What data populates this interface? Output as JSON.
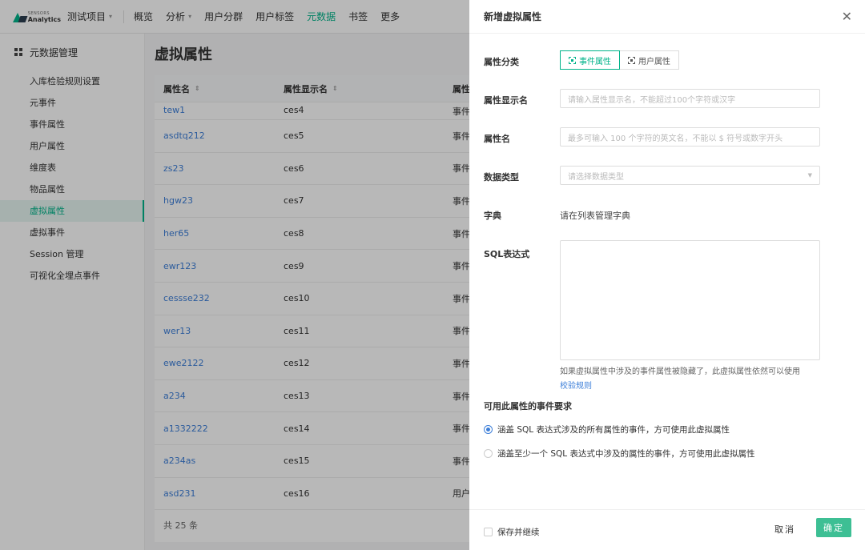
{
  "topnav": {
    "logo_line1": "SENSORS",
    "logo_line2": "Analytics",
    "project": "测试项目",
    "items": [
      {
        "label": "概览",
        "caret": false,
        "active": false
      },
      {
        "label": "分析",
        "caret": true,
        "active": false
      },
      {
        "label": "用户分群",
        "caret": false,
        "active": false
      },
      {
        "label": "用户标签",
        "caret": false,
        "active": false
      },
      {
        "label": "元数据",
        "caret": false,
        "active": true
      },
      {
        "label": "书签",
        "caret": false,
        "active": false
      },
      {
        "label": "更多",
        "caret": false,
        "active": false
      }
    ]
  },
  "sidebar": {
    "title": "元数据管理",
    "items": [
      {
        "label": "入库检验规则设置",
        "active": false
      },
      {
        "label": "元事件",
        "active": false
      },
      {
        "label": "事件属性",
        "active": false
      },
      {
        "label": "用户属性",
        "active": false
      },
      {
        "label": "维度表",
        "active": false
      },
      {
        "label": "物品属性",
        "active": false
      },
      {
        "label": "虚拟属性",
        "active": true
      },
      {
        "label": "虚拟事件",
        "active": false
      },
      {
        "label": "Session 管理",
        "active": false
      },
      {
        "label": "可视化全埋点事件",
        "active": false
      }
    ]
  },
  "main": {
    "title": "虚拟属性",
    "columns": [
      "属性名",
      "属性显示名",
      "属性"
    ],
    "rows": [
      {
        "name": "tew1",
        "display": "ces4",
        "type": "事件"
      },
      {
        "name": "asdtq212",
        "display": "ces5",
        "type": "事件"
      },
      {
        "name": "zs23",
        "display": "ces6",
        "type": "事件"
      },
      {
        "name": "hgw23",
        "display": "ces7",
        "type": "事件"
      },
      {
        "name": "her65",
        "display": "ces8",
        "type": "事件"
      },
      {
        "name": "ewr123",
        "display": "ces9",
        "type": "事件"
      },
      {
        "name": "cessse232",
        "display": "ces10",
        "type": "事件"
      },
      {
        "name": "wer13",
        "display": "ces11",
        "type": "事件"
      },
      {
        "name": "ewe2122",
        "display": "ces12",
        "type": "事件"
      },
      {
        "name": "a234",
        "display": "ces13",
        "type": "事件"
      },
      {
        "name": "a1332222",
        "display": "ces14",
        "type": "事件"
      },
      {
        "name": "a234as",
        "display": "ces15",
        "type": "事件"
      },
      {
        "name": "asd231",
        "display": "ces16",
        "type": "用户"
      }
    ],
    "total": "共 25 条"
  },
  "drawer": {
    "title": "新增虚拟属性",
    "category_label": "属性分类",
    "category_options": [
      "事件属性",
      "用户属性"
    ],
    "display_name_label": "属性显示名",
    "display_name_placeholder": "请输入属性显示名，不能超过100个字符或汉字",
    "name_label": "属性名",
    "name_placeholder": "最多可输入 100 个字符的英文名，不能以 $ 符号或数字开头",
    "data_type_label": "数据类型",
    "data_type_placeholder": "请选择数据类型",
    "dict_label": "字典",
    "dict_text": "请在列表管理字典",
    "sql_label": "SQL表达式",
    "sql_hint": "如果虚拟属性中涉及的事件属性被隐藏了，此虚拟属性依然可以使用",
    "sql_link": "校验规则",
    "event_req_label": "可用此属性的事件要求",
    "radio_all": "涵盖 SQL 表达式涉及的所有属性的事件，方可使用此虚拟属性",
    "radio_any": "涵盖至少一个 SQL 表达式中涉及的属性的事件，方可使用此虚拟属性",
    "save_continue": "保存并继续",
    "cancel": "取消",
    "ok": "确定"
  },
  "colors": {
    "accent": "#00b38a",
    "link": "#3d7fd9",
    "ok_button": "#3dbf94"
  }
}
